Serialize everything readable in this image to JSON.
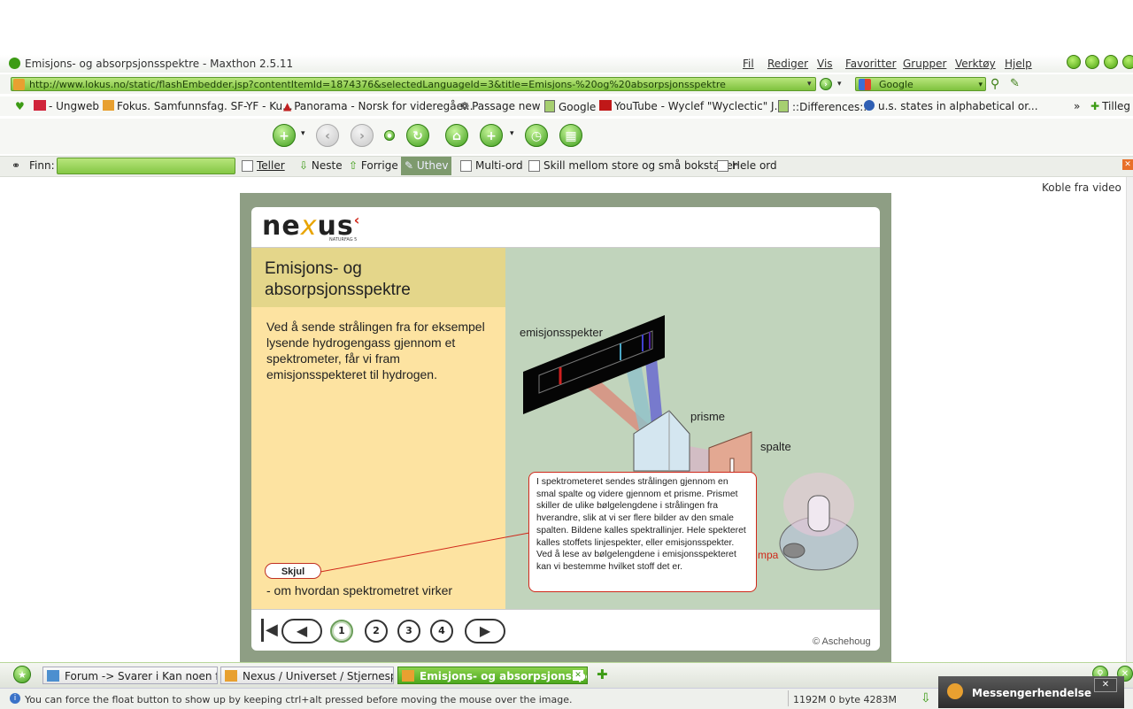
{
  "window": {
    "title": "Emisjons- og absorpsjonsspektre - Maxthon 2.5.11",
    "menu": [
      "Fil",
      "Rediger",
      "Vis",
      "Favoritter",
      "Grupper",
      "Verktøy",
      "Hjelp"
    ]
  },
  "address_bar": {
    "url": "http://www.lokus.no/static/flashEmbedder.jsp?contentItemId=1874376&selectedLanguageId=3&title=Emisjons-%20og%20absorpsjonsspektre",
    "search_value": "Google"
  },
  "favorites": [
    "- Ungweb",
    "Fokus. Samfunnsfag. SF-YF - Ku...",
    "Panorama - Norsk for videregåe...",
    "Passage new",
    "Google",
    "YouTube - Wyclef \"Wyclectic\" J...",
    "::Differences::",
    "u.s. states in alphabetical or...",
    "Tilleg"
  ],
  "findbar": {
    "label": "Finn:",
    "teller": "Teller",
    "next": "Neste",
    "prev": "Forrige",
    "highlight": "Uthev",
    "multi": "Multi-ord",
    "case": "Skill mellom store og små bokstaver",
    "whole": "Hele ord"
  },
  "content": {
    "detach_video": "Koble fra video",
    "logo_text_a": "ne",
    "logo_text_x": "x",
    "logo_text_b": "us",
    "logo_sub": "NATURFAG 5",
    "heading_line1": "Emisjons- og",
    "heading_line2": "absorpsjonsspektre",
    "paragraph": "Ved å sende strålingen fra for eksempel lysende hydrogengass gjennom et spektrometer, får vi fram emisjonsspekteret til hydrogen.",
    "diagram_labels": {
      "spectrum": "emisjonsspekter",
      "prism": "prisme",
      "slit": "spalte",
      "lamp_partial": "mpa"
    },
    "popup_text": "I spektrometeret sendes strålingen gjennom en smal spalte og videre gjennom et prisme. Prismet skiller de ulike bølgelengdene i strålingen fra hverandre, slik at vi ser flere bilder av den smale spalten. Bildene kalles spektrallinjer. Hele spekteret kalles stoffets linjespekter, eller emisjonsspekter. Ved å lese av bølgelengdene i emisjonsspekteret kan vi bestemme hvilket stoff det er.",
    "hide_button": "Skjul",
    "caption": "- om hvordan spektrometret virker",
    "pages": [
      "1",
      "2",
      "3",
      "4"
    ],
    "copyright": "© Aschehoug"
  },
  "taskbar": {
    "tabs": [
      "Forum -> Svarer i Kan noen fo...",
      "Nexus / Universet / Stjernespe...",
      "Emisjons- og absorpsjonsspe..."
    ]
  },
  "status": {
    "text": "You can force the float button to show up by keeping ctrl+alt pressed before moving the mouse over the image.",
    "memory": "1192M 0 byte 4283M",
    "messenger": "Messengerhendelse"
  }
}
